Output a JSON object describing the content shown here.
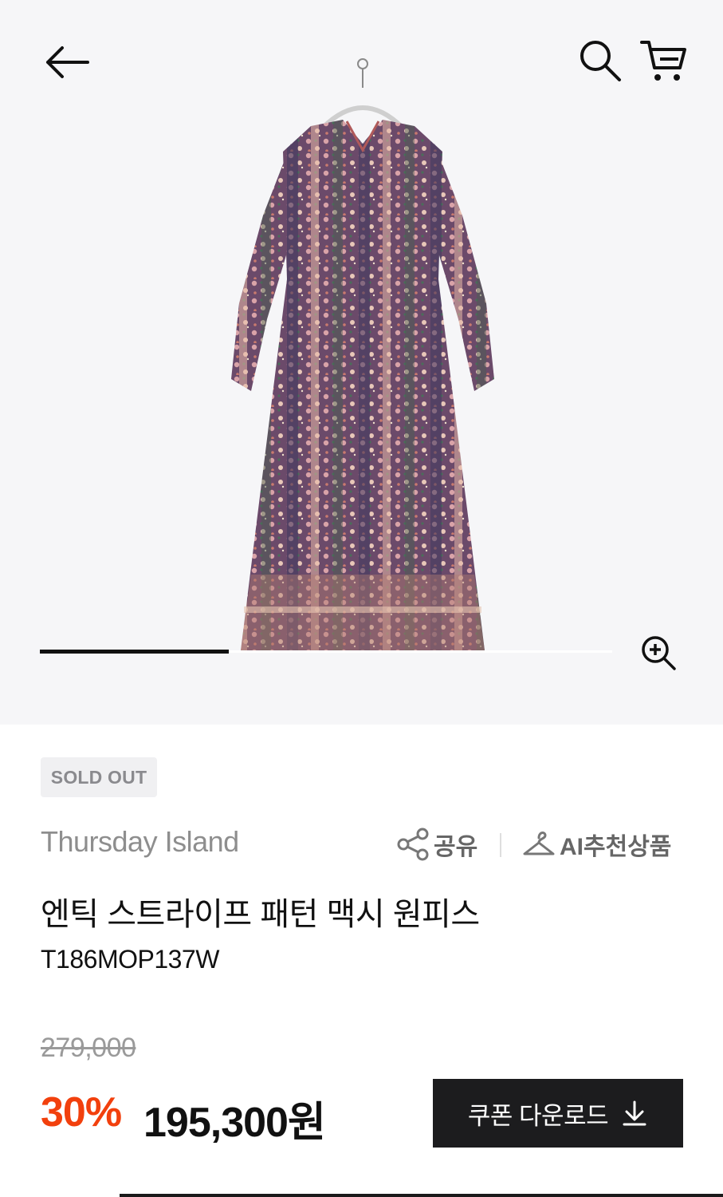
{
  "gallery": {
    "slide_progress": 0.33,
    "image_alt": "엔틱 스트라이프 패턴 맥시 원피스"
  },
  "header": {
    "back_icon": "arrow-left-icon",
    "search_icon": "search-icon",
    "cart_icon": "cart-icon"
  },
  "product": {
    "status_badge": "SOLD OUT",
    "brand": "Thursday Island",
    "name": "엔틱 스트라이프 패턴 맥시 원피스",
    "code": "T186MOP137W",
    "original_price": "279,000",
    "discount_rate": "30%",
    "sale_price": "195,300원"
  },
  "actions": {
    "share_label": "공유",
    "ai_label": "AI추천상품",
    "coupon_label": "쿠폰 다운로드"
  },
  "colors": {
    "discount": "#f2400d",
    "button_bg": "#1c1c1e",
    "badge_bg": "#f0f0f2"
  }
}
